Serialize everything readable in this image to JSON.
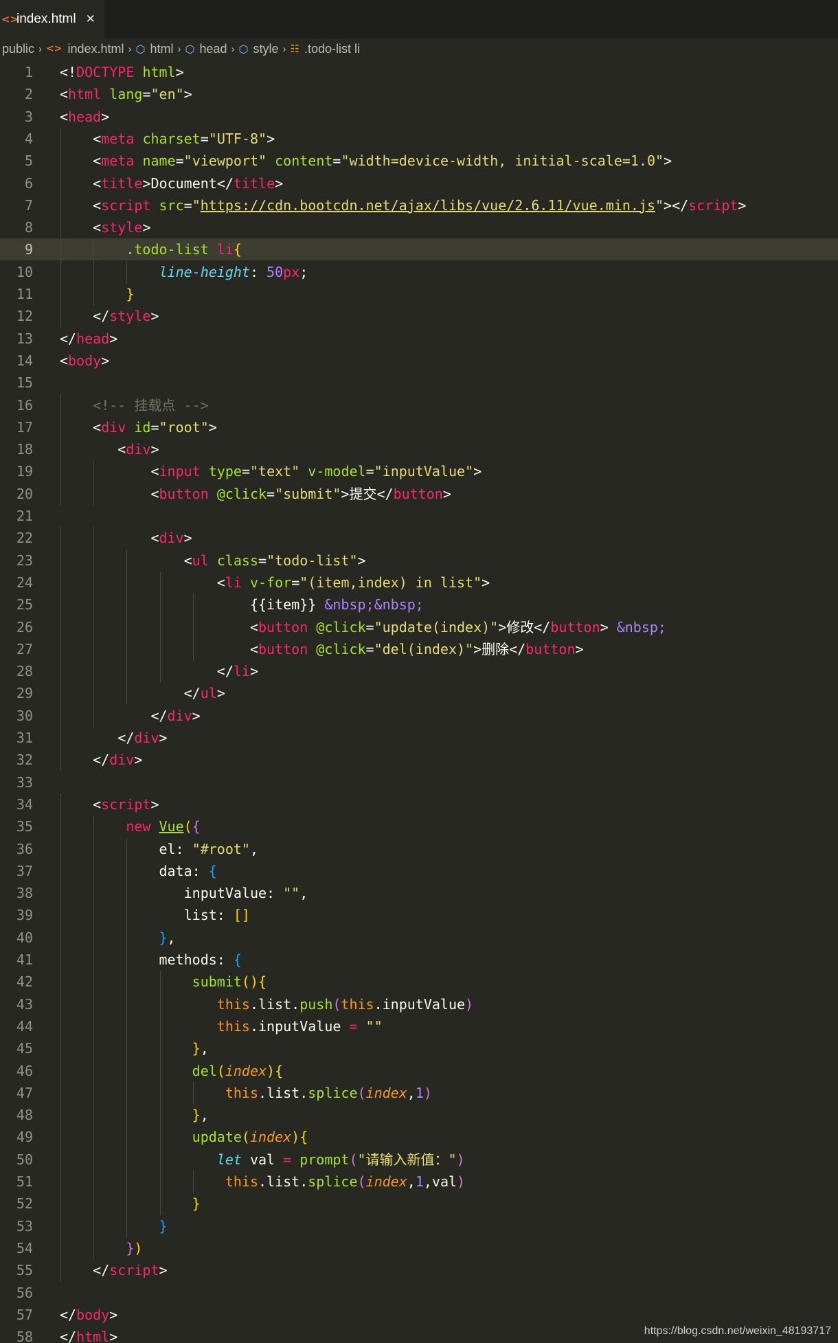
{
  "tab": {
    "label": "index.html",
    "icon": "html-file-icon",
    "close_glyph": "✕"
  },
  "breadcrumb": [
    {
      "label": "public",
      "icon": ""
    },
    {
      "label": "index.html",
      "icon": "html-file-icon"
    },
    {
      "label": "html",
      "icon": "cube-icon"
    },
    {
      "label": "head",
      "icon": "cube-icon"
    },
    {
      "label": "style",
      "icon": "cube-icon"
    },
    {
      "label": ".todo-list li",
      "icon": "css-selector-icon"
    }
  ],
  "active_line": 9,
  "code_lines": [
    [
      [
        "t-punct",
        "<!"
      ],
      [
        "t-tag",
        "DOCTYPE"
      ],
      [
        "t-plain",
        " "
      ],
      [
        "t-attr",
        "html"
      ],
      [
        "t-punct",
        ">"
      ]
    ],
    [
      [
        "t-punct",
        "<"
      ],
      [
        "t-tag",
        "html"
      ],
      [
        "t-plain",
        " "
      ],
      [
        "t-attr",
        "lang"
      ],
      [
        "t-punct",
        "="
      ],
      [
        "t-str",
        "\"en\""
      ],
      [
        "t-punct",
        ">"
      ]
    ],
    [
      [
        "t-punct",
        "<"
      ],
      [
        "t-tag",
        "head"
      ],
      [
        "t-punct",
        ">"
      ]
    ],
    [
      [
        "t-plain",
        "    "
      ],
      [
        "t-punct",
        "<"
      ],
      [
        "t-tag",
        "meta"
      ],
      [
        "t-plain",
        " "
      ],
      [
        "t-attr",
        "charset"
      ],
      [
        "t-punct",
        "="
      ],
      [
        "t-str",
        "\"UTF-8\""
      ],
      [
        "t-punct",
        ">"
      ]
    ],
    [
      [
        "t-plain",
        "    "
      ],
      [
        "t-punct",
        "<"
      ],
      [
        "t-tag",
        "meta"
      ],
      [
        "t-plain",
        " "
      ],
      [
        "t-attr",
        "name"
      ],
      [
        "t-punct",
        "="
      ],
      [
        "t-str",
        "\"viewport\""
      ],
      [
        "t-plain",
        " "
      ],
      [
        "t-attr",
        "content"
      ],
      [
        "t-punct",
        "="
      ],
      [
        "t-str",
        "\"width=device-width, initial-scale=1.0\""
      ],
      [
        "t-punct",
        ">"
      ]
    ],
    [
      [
        "t-plain",
        "    "
      ],
      [
        "t-punct",
        "<"
      ],
      [
        "t-tag",
        "title"
      ],
      [
        "t-punct",
        ">"
      ],
      [
        "t-plain",
        "Document"
      ],
      [
        "t-punct",
        "</"
      ],
      [
        "t-tag",
        "title"
      ],
      [
        "t-punct",
        ">"
      ]
    ],
    [
      [
        "t-plain",
        "    "
      ],
      [
        "t-punct",
        "<"
      ],
      [
        "t-tag",
        "script"
      ],
      [
        "t-plain",
        " "
      ],
      [
        "t-attr",
        "src"
      ],
      [
        "t-punct",
        "="
      ],
      [
        "t-str",
        "\""
      ],
      [
        "t-url",
        "https://cdn.bootcdn.net/ajax/libs/vue/2.6.11/vue.min.js"
      ],
      [
        "t-str",
        "\""
      ],
      [
        "t-punct",
        "></"
      ],
      [
        "t-tag",
        "script"
      ],
      [
        "t-punct",
        ">"
      ]
    ],
    [
      [
        "t-plain",
        "    "
      ],
      [
        "t-punct",
        "<"
      ],
      [
        "t-tag",
        "style"
      ],
      [
        "t-punct",
        ">"
      ]
    ],
    [
      [
        "t-plain",
        "        "
      ],
      [
        "t-attr",
        ".todo-list"
      ],
      [
        "t-plain",
        " "
      ],
      [
        "t-tag",
        "li"
      ],
      [
        "t-brace1",
        "{"
      ]
    ],
    [
      [
        "t-plain",
        "            "
      ],
      [
        "t-prop",
        "line-height"
      ],
      [
        "t-punct",
        ": "
      ],
      [
        "t-num",
        "50"
      ],
      [
        "t-kw",
        "px"
      ],
      [
        "t-punct",
        ";"
      ]
    ],
    [
      [
        "t-plain",
        "        "
      ],
      [
        "t-brace1",
        "}"
      ]
    ],
    [
      [
        "t-plain",
        "    "
      ],
      [
        "t-punct",
        "</"
      ],
      [
        "t-tag",
        "style"
      ],
      [
        "t-punct",
        ">"
      ]
    ],
    [
      [
        "t-punct",
        "</"
      ],
      [
        "t-tag",
        "head"
      ],
      [
        "t-punct",
        ">"
      ]
    ],
    [
      [
        "t-punct",
        "<"
      ],
      [
        "t-tag",
        "body"
      ],
      [
        "t-punct",
        ">"
      ]
    ],
    [],
    [
      [
        "t-plain",
        "    "
      ],
      [
        "t-comment",
        "<!-- 挂载点 -->"
      ]
    ],
    [
      [
        "t-plain",
        "    "
      ],
      [
        "t-punct",
        "<"
      ],
      [
        "t-tag",
        "div"
      ],
      [
        "t-plain",
        " "
      ],
      [
        "t-attr",
        "id"
      ],
      [
        "t-punct",
        "="
      ],
      [
        "t-str",
        "\"root\""
      ],
      [
        "t-punct",
        ">"
      ]
    ],
    [
      [
        "t-plain",
        "       "
      ],
      [
        "t-punct",
        "<"
      ],
      [
        "t-tag",
        "div"
      ],
      [
        "t-punct",
        ">"
      ]
    ],
    [
      [
        "t-plain",
        "           "
      ],
      [
        "t-punct",
        "<"
      ],
      [
        "t-tag",
        "input"
      ],
      [
        "t-plain",
        " "
      ],
      [
        "t-attr",
        "type"
      ],
      [
        "t-punct",
        "="
      ],
      [
        "t-str",
        "\"text\""
      ],
      [
        "t-plain",
        " "
      ],
      [
        "t-attr",
        "v-model"
      ],
      [
        "t-punct",
        "="
      ],
      [
        "t-str",
        "\"inputValue\""
      ],
      [
        "t-punct",
        ">"
      ]
    ],
    [
      [
        "t-plain",
        "           "
      ],
      [
        "t-punct",
        "<"
      ],
      [
        "t-tag",
        "button"
      ],
      [
        "t-plain",
        " "
      ],
      [
        "t-attr",
        "@click"
      ],
      [
        "t-punct",
        "="
      ],
      [
        "t-str",
        "\"submit\""
      ],
      [
        "t-punct",
        ">"
      ],
      [
        "t-plain",
        "提交"
      ],
      [
        "t-punct",
        "</"
      ],
      [
        "t-tag",
        "button"
      ],
      [
        "t-punct",
        ">"
      ]
    ],
    [],
    [
      [
        "t-plain",
        "           "
      ],
      [
        "t-punct",
        "<"
      ],
      [
        "t-tag",
        "div"
      ],
      [
        "t-punct",
        ">"
      ]
    ],
    [
      [
        "t-plain",
        "               "
      ],
      [
        "t-punct",
        "<"
      ],
      [
        "t-tag",
        "ul"
      ],
      [
        "t-plain",
        " "
      ],
      [
        "t-attr",
        "class"
      ],
      [
        "t-punct",
        "="
      ],
      [
        "t-str",
        "\"todo-list\""
      ],
      [
        "t-punct",
        ">"
      ]
    ],
    [
      [
        "t-plain",
        "                   "
      ],
      [
        "t-punct",
        "<"
      ],
      [
        "t-tag",
        "li"
      ],
      [
        "t-plain",
        " "
      ],
      [
        "t-attr",
        "v-for"
      ],
      [
        "t-punct",
        "="
      ],
      [
        "t-str",
        "\"(item,index) in list\""
      ],
      [
        "t-punct",
        ">"
      ]
    ],
    [
      [
        "t-plain",
        "                       "
      ],
      [
        "t-plain",
        "{{item}} "
      ],
      [
        "t-entity",
        "&nbsp;&nbsp;"
      ]
    ],
    [
      [
        "t-plain",
        "                       "
      ],
      [
        "t-punct",
        "<"
      ],
      [
        "t-tag",
        "button"
      ],
      [
        "t-plain",
        " "
      ],
      [
        "t-attr",
        "@click"
      ],
      [
        "t-punct",
        "="
      ],
      [
        "t-str",
        "\"update(index)\""
      ],
      [
        "t-punct",
        ">"
      ],
      [
        "t-plain",
        "修改"
      ],
      [
        "t-punct",
        "</"
      ],
      [
        "t-tag",
        "button"
      ],
      [
        "t-punct",
        "> "
      ],
      [
        "t-entity",
        "&nbsp;"
      ]
    ],
    [
      [
        "t-plain",
        "                       "
      ],
      [
        "t-punct",
        "<"
      ],
      [
        "t-tag",
        "button"
      ],
      [
        "t-plain",
        " "
      ],
      [
        "t-attr",
        "@click"
      ],
      [
        "t-punct",
        "="
      ],
      [
        "t-str",
        "\"del(index)\""
      ],
      [
        "t-punct",
        ">"
      ],
      [
        "t-plain",
        "删除"
      ],
      [
        "t-punct",
        "</"
      ],
      [
        "t-tag",
        "button"
      ],
      [
        "t-punct",
        ">"
      ]
    ],
    [
      [
        "t-plain",
        "                   "
      ],
      [
        "t-punct",
        "</"
      ],
      [
        "t-tag",
        "li"
      ],
      [
        "t-punct",
        ">"
      ]
    ],
    [
      [
        "t-plain",
        "               "
      ],
      [
        "t-punct",
        "</"
      ],
      [
        "t-tag",
        "ul"
      ],
      [
        "t-punct",
        ">"
      ]
    ],
    [
      [
        "t-plain",
        "           "
      ],
      [
        "t-punct",
        "</"
      ],
      [
        "t-tag",
        "div"
      ],
      [
        "t-punct",
        ">"
      ]
    ],
    [
      [
        "t-plain",
        "       "
      ],
      [
        "t-punct",
        "</"
      ],
      [
        "t-tag",
        "div"
      ],
      [
        "t-punct",
        ">"
      ]
    ],
    [
      [
        "t-plain",
        "    "
      ],
      [
        "t-punct",
        "</"
      ],
      [
        "t-tag",
        "div"
      ],
      [
        "t-punct",
        ">"
      ]
    ],
    [],
    [
      [
        "t-plain",
        "    "
      ],
      [
        "t-punct",
        "<"
      ],
      [
        "t-tag",
        "script"
      ],
      [
        "t-punct",
        ">"
      ]
    ],
    [
      [
        "t-plain",
        "        "
      ],
      [
        "t-kw",
        "new"
      ],
      [
        "t-plain",
        " "
      ],
      [
        "t-class",
        "Vue"
      ],
      [
        "t-brace1",
        "("
      ],
      [
        "t-brace2",
        "{"
      ]
    ],
    [
      [
        "t-plain",
        "            "
      ],
      [
        "t-plain",
        "el: "
      ],
      [
        "t-str",
        "\"#root\""
      ],
      [
        "t-plain",
        ","
      ]
    ],
    [
      [
        "t-plain",
        "            "
      ],
      [
        "t-plain",
        "data: "
      ],
      [
        "t-brace3",
        "{"
      ]
    ],
    [
      [
        "t-plain",
        "               "
      ],
      [
        "t-plain",
        "inputValue: "
      ],
      [
        "t-str",
        "\"\""
      ],
      [
        "t-plain",
        ","
      ]
    ],
    [
      [
        "t-plain",
        "               "
      ],
      [
        "t-plain",
        "list: "
      ],
      [
        "t-brace1",
        "[]"
      ]
    ],
    [
      [
        "t-plain",
        "            "
      ],
      [
        "t-brace3",
        "}"
      ],
      [
        "t-plain",
        ","
      ]
    ],
    [
      [
        "t-plain",
        "            "
      ],
      [
        "t-plain",
        "methods: "
      ],
      [
        "t-brace3",
        "{"
      ]
    ],
    [
      [
        "t-plain",
        "                "
      ],
      [
        "t-fn",
        "submit"
      ],
      [
        "t-brace1",
        "()"
      ],
      [
        "t-brace1",
        "{"
      ]
    ],
    [
      [
        "t-plain",
        "                   "
      ],
      [
        "t-this",
        "this"
      ],
      [
        "t-plain",
        ".list."
      ],
      [
        "t-fn",
        "push"
      ],
      [
        "t-brace2",
        "("
      ],
      [
        "t-this",
        "this"
      ],
      [
        "t-plain",
        ".inputValue"
      ],
      [
        "t-brace2",
        ")"
      ]
    ],
    [
      [
        "t-plain",
        "                   "
      ],
      [
        "t-this",
        "this"
      ],
      [
        "t-plain",
        ".inputValue "
      ],
      [
        "t-op",
        "="
      ],
      [
        "t-plain",
        " "
      ],
      [
        "t-str",
        "\"\""
      ]
    ],
    [
      [
        "t-plain",
        "                "
      ],
      [
        "t-brace1",
        "}"
      ],
      [
        "t-plain",
        ","
      ]
    ],
    [
      [
        "t-plain",
        "                "
      ],
      [
        "t-fn",
        "del"
      ],
      [
        "t-brace1",
        "("
      ],
      [
        "t-param",
        "index"
      ],
      [
        "t-brace1",
        ")"
      ],
      [
        "t-brace1",
        "{"
      ]
    ],
    [
      [
        "t-plain",
        "                    "
      ],
      [
        "t-this",
        "this"
      ],
      [
        "t-plain",
        ".list."
      ],
      [
        "t-fn",
        "splice"
      ],
      [
        "t-brace2",
        "("
      ],
      [
        "t-param",
        "index"
      ],
      [
        "t-plain",
        ","
      ],
      [
        "t-num",
        "1"
      ],
      [
        "t-brace2",
        ")"
      ]
    ],
    [
      [
        "t-plain",
        "                "
      ],
      [
        "t-brace1",
        "}"
      ],
      [
        "t-plain",
        ","
      ]
    ],
    [
      [
        "t-plain",
        "                "
      ],
      [
        "t-fn",
        "update"
      ],
      [
        "t-brace1",
        "("
      ],
      [
        "t-param",
        "index"
      ],
      [
        "t-brace1",
        ")"
      ],
      [
        "t-brace1",
        "{"
      ]
    ],
    [
      [
        "t-plain",
        "                   "
      ],
      [
        "t-let",
        "let"
      ],
      [
        "t-plain",
        " val "
      ],
      [
        "t-op",
        "="
      ],
      [
        "t-plain",
        " "
      ],
      [
        "t-fn",
        "prompt"
      ],
      [
        "t-brace2",
        "("
      ],
      [
        "t-str",
        "\"请输入新值：\""
      ],
      [
        "t-brace2",
        ")"
      ]
    ],
    [
      [
        "t-plain",
        "                    "
      ],
      [
        "t-this",
        "this"
      ],
      [
        "t-plain",
        ".list."
      ],
      [
        "t-fn",
        "splice"
      ],
      [
        "t-brace2",
        "("
      ],
      [
        "t-param",
        "index"
      ],
      [
        "t-plain",
        ","
      ],
      [
        "t-num",
        "1"
      ],
      [
        "t-plain",
        ",val"
      ],
      [
        "t-brace2",
        ")"
      ]
    ],
    [
      [
        "t-plain",
        "                "
      ],
      [
        "t-brace1",
        "}"
      ]
    ],
    [
      [
        "t-plain",
        "            "
      ],
      [
        "t-brace3",
        "}"
      ]
    ],
    [
      [
        "t-plain",
        "        "
      ],
      [
        "t-brace2",
        "}"
      ],
      [
        "t-brace1",
        ")"
      ]
    ],
    [
      [
        "t-plain",
        "    "
      ],
      [
        "t-punct",
        "</"
      ],
      [
        "t-tag",
        "script"
      ],
      [
        "t-punct",
        ">"
      ]
    ],
    [],
    [
      [
        "t-punct",
        "</"
      ],
      [
        "t-tag",
        "body"
      ],
      [
        "t-punct",
        ">"
      ]
    ],
    [
      [
        "t-punct",
        "</"
      ],
      [
        "t-tag",
        "html"
      ],
      [
        "t-punct",
        ">"
      ]
    ]
  ],
  "watermark": "https://blog.csdn.net/weixin_48193717"
}
